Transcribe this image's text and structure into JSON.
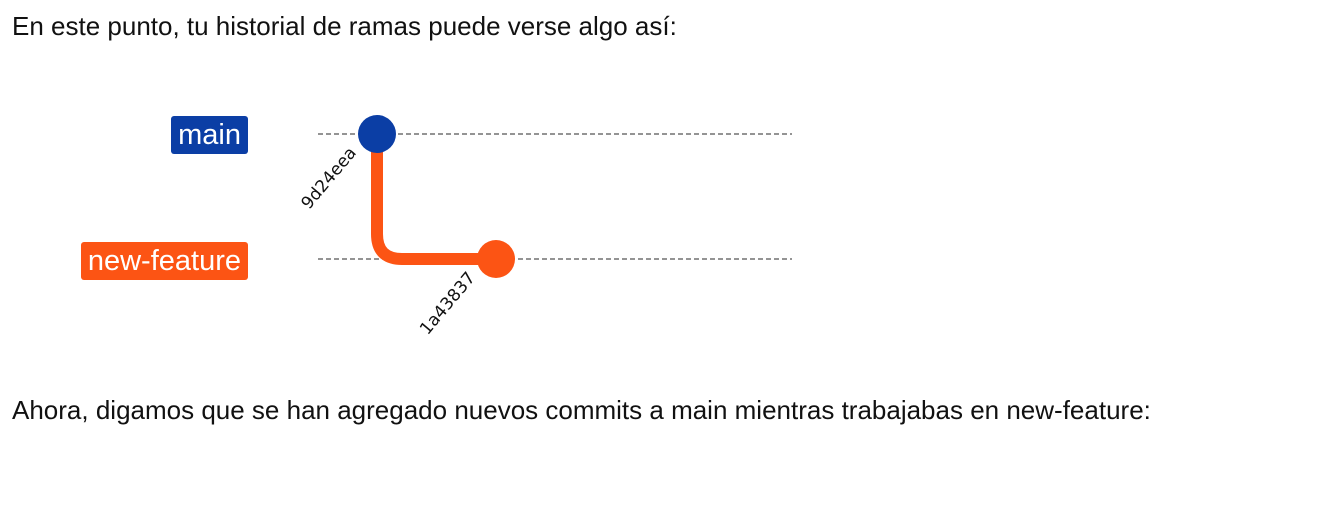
{
  "intro_text": "En este punto, tu historial de ramas puede verse algo así:",
  "outro_text": "Ahora, digamos que se han agregado nuevos commits a main mientras trabajabas en new-feature:",
  "branches": [
    {
      "name": "main",
      "color": "#0b3ea5"
    },
    {
      "name": "new-feature",
      "color": "#fc5414"
    }
  ],
  "commits": [
    {
      "hash": "9d24eea",
      "branch": "main"
    },
    {
      "hash": "1a43837",
      "branch": "new-feature"
    }
  ],
  "colors": {
    "guide_line": "#555555",
    "text": "#111111"
  }
}
